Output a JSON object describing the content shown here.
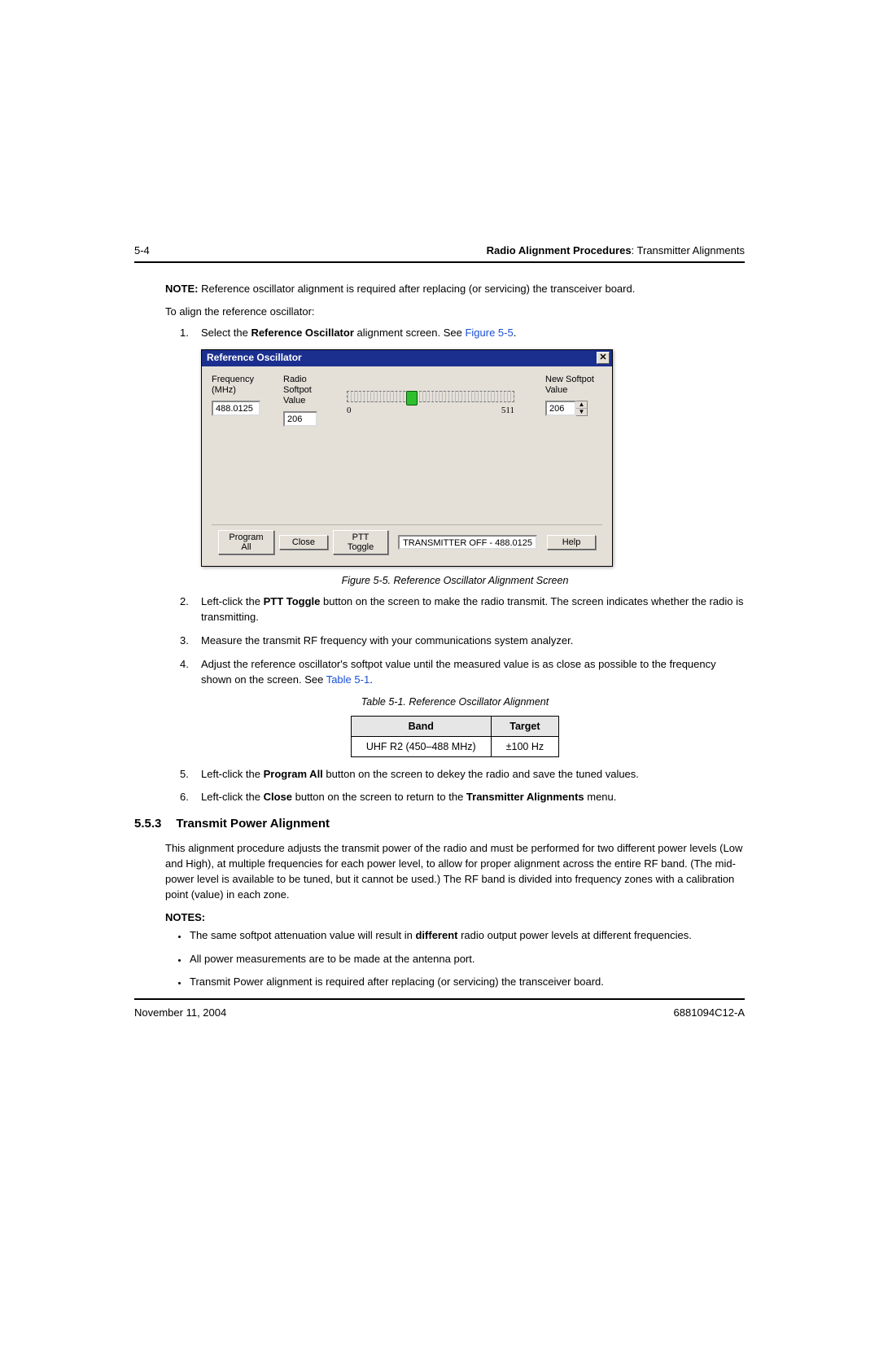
{
  "page_number": "5-4",
  "header_section": {
    "bold": "Radio Alignment Procedures",
    "rest": ": Transmitter Alignments"
  },
  "note": {
    "label": "NOTE:",
    "text": "Reference oscillator alignment is required after replacing (or servicing) the transceiver board."
  },
  "intro": "To align the reference oscillator:",
  "step1": {
    "num": "1.",
    "t1": "Select the ",
    "bold": "Reference Oscillator",
    "t2": " alignment screen. See ",
    "link": "Figure 5-5",
    "t3": "."
  },
  "dialog": {
    "title": "Reference Oscillator",
    "labels": {
      "freq": "Frequency (MHz)",
      "radio": "Radio Softpot Value",
      "new": "New Softpot Value"
    },
    "freq_value": "488.0125",
    "radio_value": "206",
    "new_value": "206",
    "ticks": {
      "min": "0",
      "max": "511"
    },
    "buttons": {
      "program_all": "Program All",
      "close": "Close",
      "ptt": "PTT Toggle",
      "help": "Help"
    },
    "status": "TRANSMITTER OFF - 488.0125",
    "close_x": "✕"
  },
  "figure_caption": "Figure 5-5.  Reference Oscillator Alignment Screen",
  "step2": {
    "num": "2.",
    "t1": "Left-click the ",
    "bold": "PTT Toggle",
    "t2": " button on the screen to make the radio transmit. The screen indicates whether the radio is transmitting."
  },
  "step3": {
    "num": "3.",
    "text": "Measure the transmit RF frequency with your communications system analyzer."
  },
  "step4": {
    "num": "4.",
    "t1": "Adjust the reference oscillator's softpot value until the measured value is as close as possible to the frequency shown on the screen. See ",
    "link": "Table 5-1",
    "t2": "."
  },
  "table_caption": "Table 5-1.  Reference Oscillator Alignment",
  "table": {
    "headers": {
      "band": "Band",
      "target": "Target"
    },
    "row": {
      "band": "UHF R2 (450–488 MHz)",
      "target": "±100 Hz"
    }
  },
  "step5": {
    "num": "5.",
    "t1": "Left-click the ",
    "bold": "Program All",
    "t2": " button on the screen to dekey the radio and save the tuned values."
  },
  "step6": {
    "num": "6.",
    "t1": "Left-click the ",
    "bold1": "Close",
    "t2": " button on the screen to return to the ",
    "bold2": "Transmitter Alignments",
    "t3": " menu."
  },
  "section": {
    "num": "5.5.3",
    "title": "Transmit Power Alignment"
  },
  "section_body": "This alignment procedure adjusts the transmit power of the radio and must be performed for two different power levels (Low and High), at multiple frequencies for each power level, to allow for proper alignment across the entire RF band. (The mid-power level is available to be tuned, but it cannot be used.) The RF band is divided into frequency zones with a calibration point (value) in each zone.",
  "notes_label": "NOTES:",
  "bullets": {
    "b1": {
      "t1": "The same softpot attenuation value will result in ",
      "bold": "different",
      "t2": " radio output power levels at different frequencies."
    },
    "b2": "All power measurements are to be made at the antenna port.",
    "b3": "Transmit Power alignment is required after replacing (or servicing) the transceiver board."
  },
  "footer": {
    "date": "November 11, 2004",
    "doc": "6881094C12-A"
  }
}
